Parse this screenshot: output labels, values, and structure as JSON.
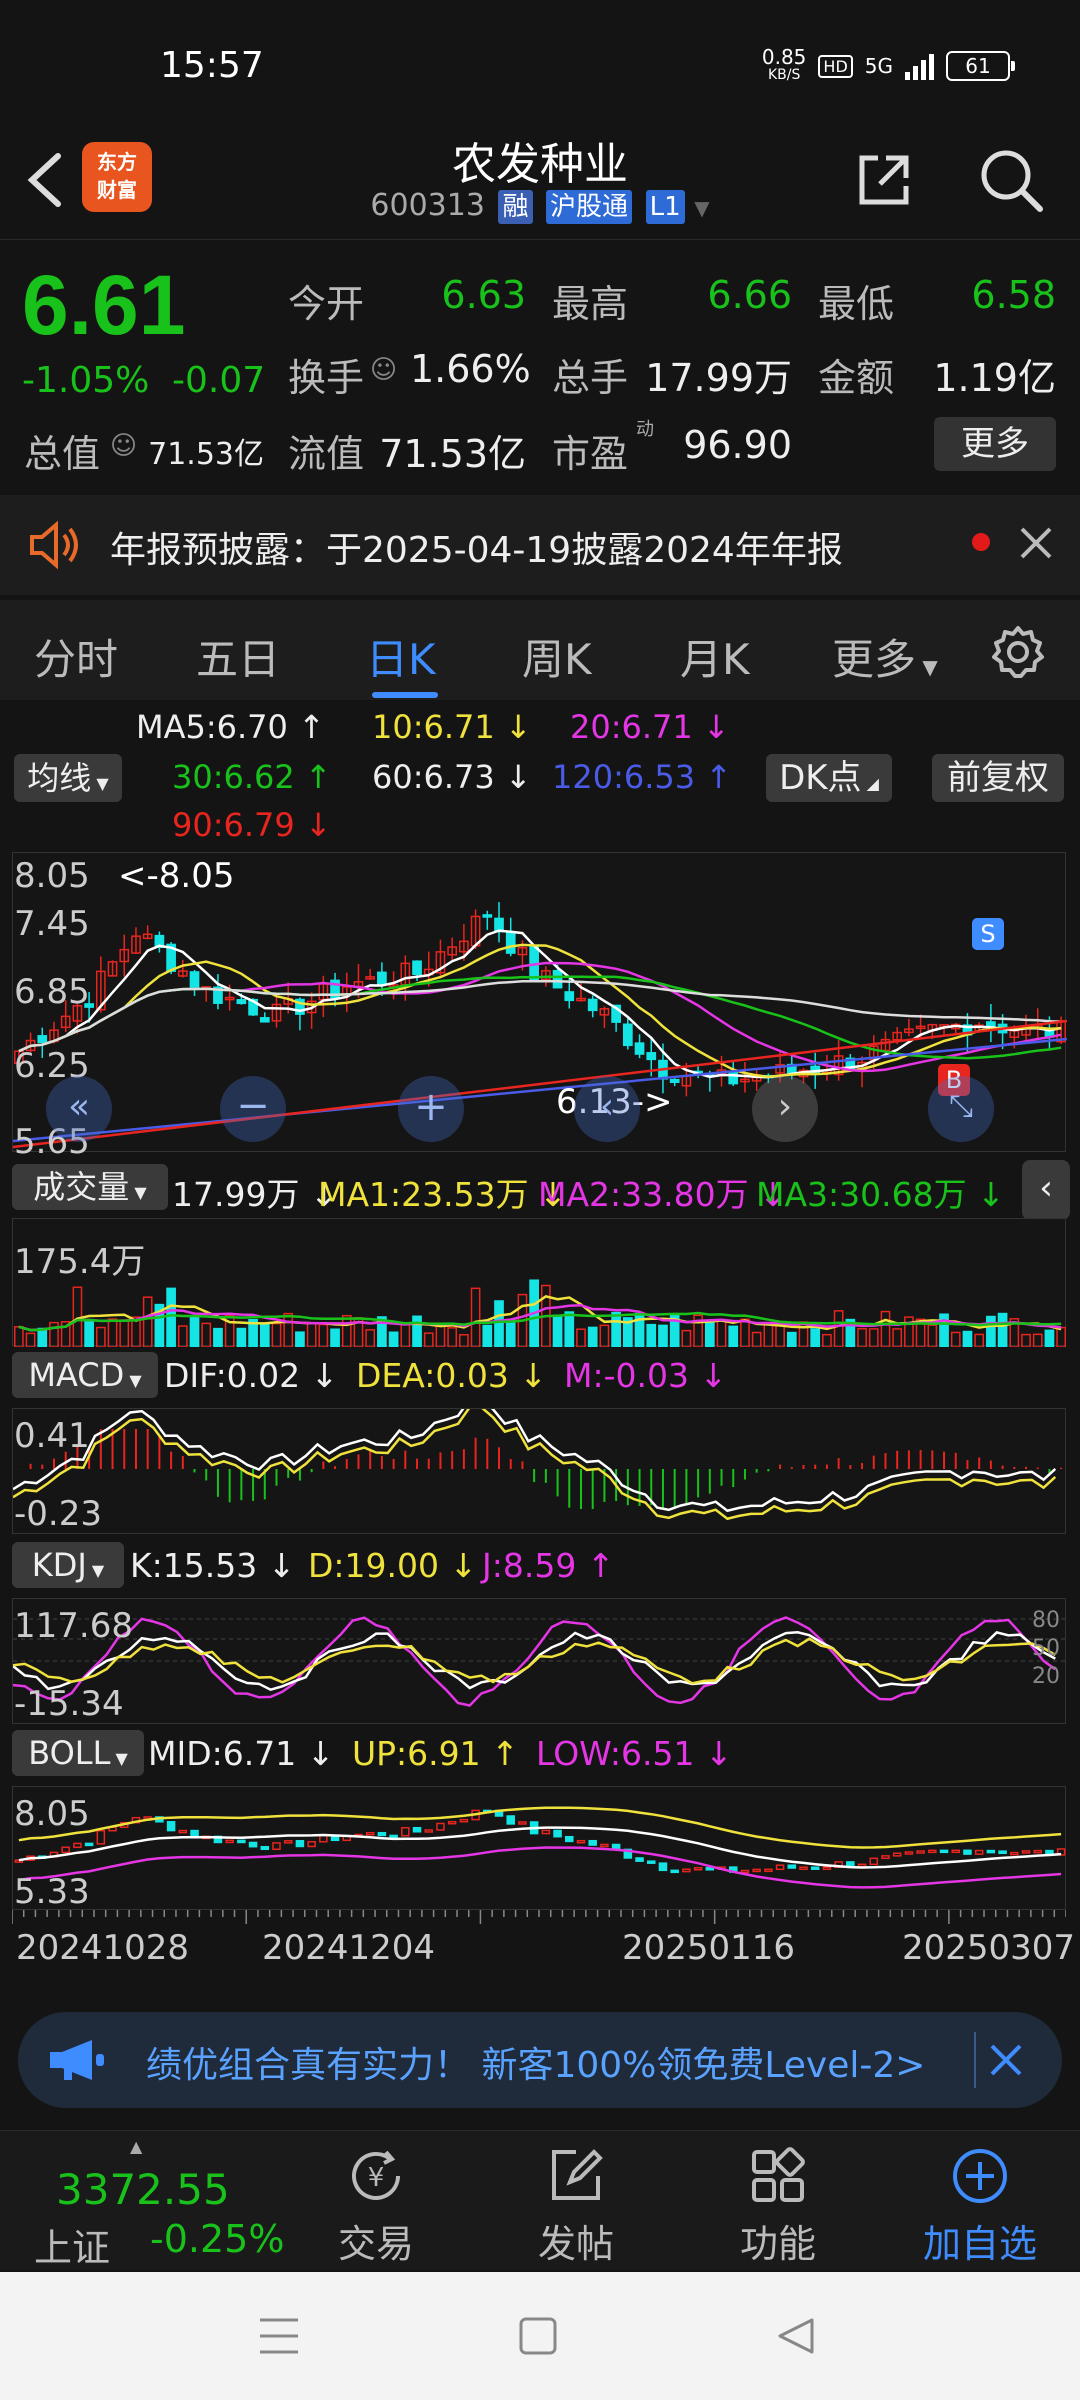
{
  "status": {
    "time": "15:57",
    "net_speed_top": "0.85",
    "net_speed_bottom": "KB/S",
    "hd": "HD",
    "signal": "5G",
    "battery": "61"
  },
  "header": {
    "logo_top": "东方",
    "logo_bottom": "财富",
    "name": "农发种业",
    "code": "600313",
    "tags": [
      "融",
      "沪股通",
      "L1"
    ]
  },
  "quote": {
    "price": "6.61",
    "pct": "-1.05%",
    "change": "-0.07",
    "open_label": "今开",
    "open": "6.63",
    "high_label": "最高",
    "high": "6.66",
    "low_label": "最低",
    "low": "6.58",
    "turnover_label": "换手",
    "turnover": "1.66%",
    "volume_label": "总手",
    "volume": "17.99万",
    "amount_label": "金额",
    "amount": "1.19亿",
    "mktcap_label": "总值",
    "mktcap": "71.53亿",
    "float_label": "流值",
    "float": "71.53亿",
    "pe_label": "市盈",
    "pe_sup": "动",
    "pe": "96.90",
    "more": "更多"
  },
  "notice": {
    "text": "年报预披露：于2025-04-19披露2024年年报"
  },
  "tabs": [
    "分时",
    "五日",
    "日K",
    "周K",
    "月K",
    "更多"
  ],
  "active_tab": "日K",
  "ma": {
    "selector": "均线",
    "ma5": "MA5:6.70",
    "ma10": "10:6.71",
    "ma20": "20:6.71",
    "ma30": "30:6.62",
    "ma60": "60:6.73",
    "ma120": "120:6.53",
    "ma90": "90:6.79",
    "dk_button": "DK点",
    "adjust_button": "前复权"
  },
  "kline": {
    "y_top": "8.05",
    "y_mid1": "7.45",
    "y_mid2": "6.85",
    "y_mid3": "6.25",
    "y_bottom": "5.65",
    "max_note": "<-8.05",
    "min_note": "6.13->",
    "sell_marker": "S",
    "buy_marker": "B"
  },
  "volume": {
    "selector": "成交量",
    "value": "17.99万",
    "ma1": "MA1:23.53万",
    "ma2": "MA2:33.80万",
    "ma3": "MA3:30.68万",
    "y_top": "175.4万"
  },
  "macd": {
    "selector": "MACD",
    "dif": "DIF:0.02",
    "dea": "DEA:0.03",
    "m": "M:-0.03",
    "y_top": "0.41",
    "y_bottom": "-0.23"
  },
  "kdj": {
    "selector": "KDJ",
    "k": "K:15.53",
    "d": "D:19.00",
    "j": "J:8.59",
    "y_top": "117.68",
    "y_bottom": "-15.34",
    "lvl80": "80",
    "lvl50": "50",
    "lvl20": "20"
  },
  "boll": {
    "selector": "BOLL",
    "mid": "MID:6.71",
    "up": "UP:6.91",
    "low": "LOW:6.51",
    "y_top": "8.05",
    "y_bottom": "5.33"
  },
  "dates": [
    "20241028",
    "20241204",
    "20250116",
    "20250307"
  ],
  "promo": {
    "text": "绩优组合真有实力！ 新客100%领免费Level-2>"
  },
  "bottom": {
    "index_value": "3372.55",
    "index_name": "上证",
    "index_pct": "-0.25%",
    "trade": "交易",
    "post": "发帖",
    "func": "功能",
    "watch": "加自选"
  },
  "colors": {
    "green": "#19c21a",
    "red": "#e8251e",
    "yellow": "#f0e23c",
    "magenta": "#e436e4",
    "blue": "#3f8cff",
    "cyan": "#14e4e4"
  }
}
